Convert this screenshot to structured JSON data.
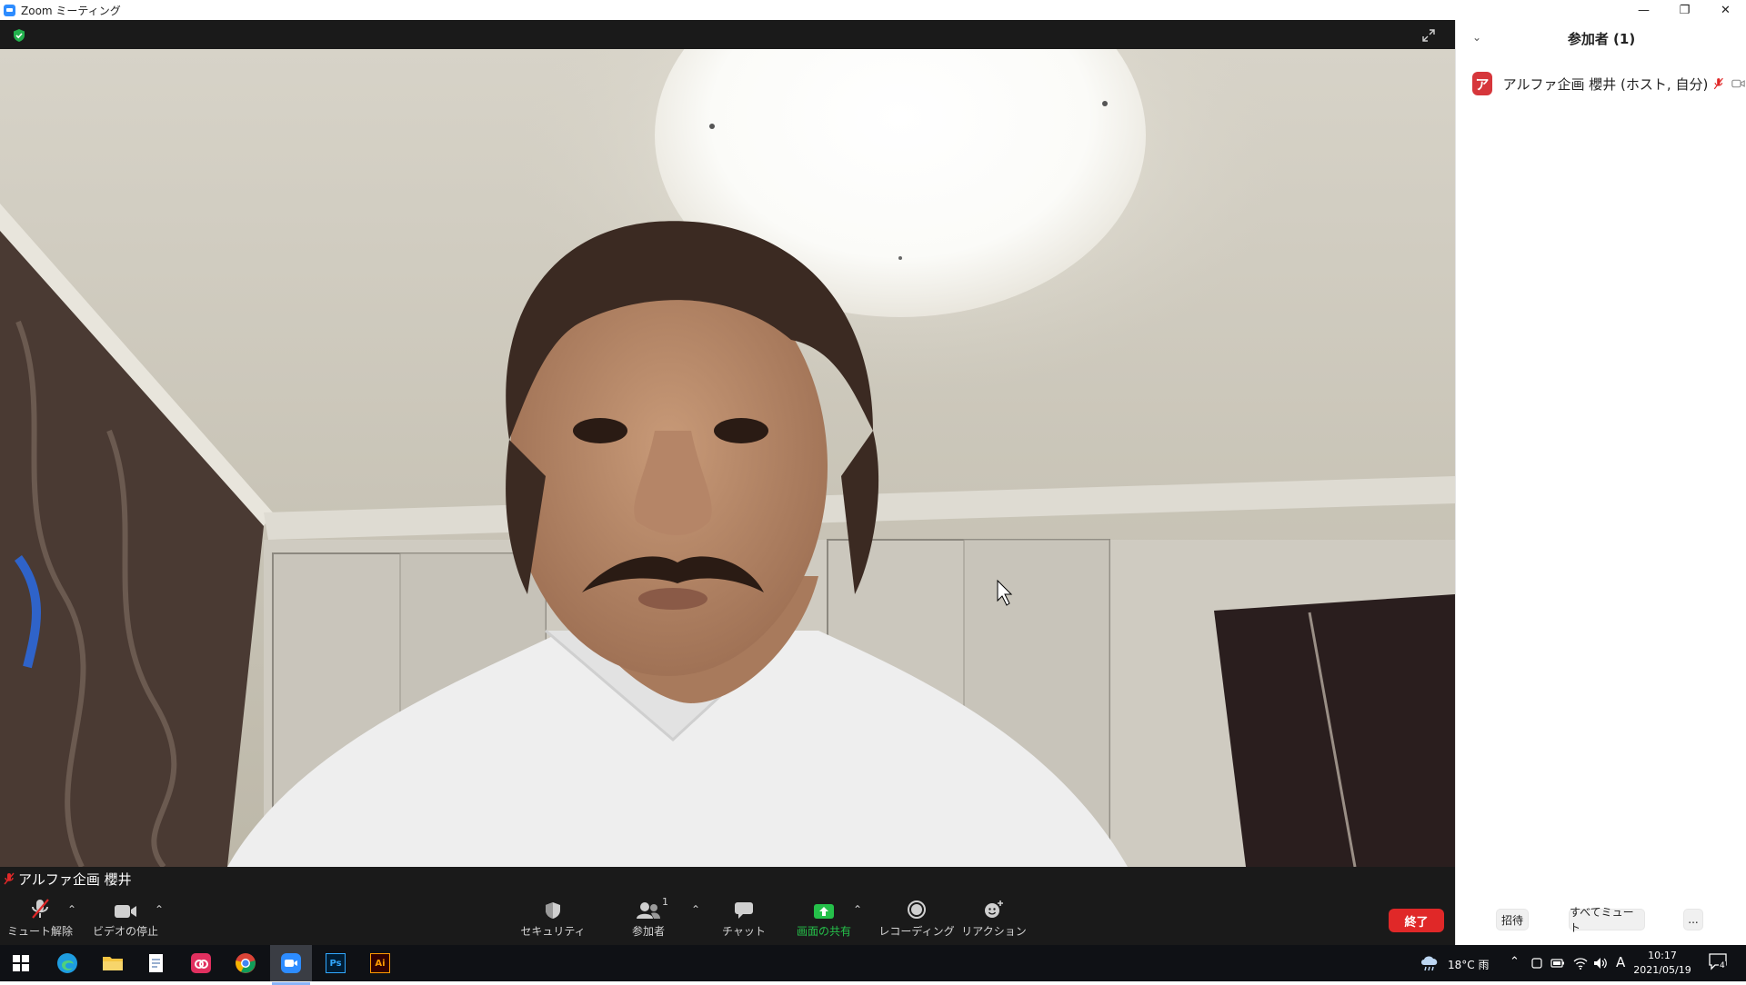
{
  "window": {
    "title": "Zoom ミーティング",
    "controls": [
      "—",
      "❐",
      "✕"
    ]
  },
  "video": {
    "participant_name": "アルファ企画 櫻井"
  },
  "toolbar": {
    "unmute": "ミュート解除",
    "stop_video": "ビデオの停止",
    "security": "セキュリティ",
    "participants": "参加者",
    "participants_count": "1",
    "chat": "チャット",
    "share_screen": "画面の共有",
    "recording": "レコーディング",
    "reactions": "リアクション",
    "end": "終了"
  },
  "panel": {
    "title": "参加者 (1)",
    "participant": {
      "avatar_letter": "ア",
      "name": "アルファ企画 櫻井 (ホスト, 自分)"
    },
    "invite": "招待",
    "mute_all": "すべてミュート",
    "more": "..."
  },
  "taskbar": {
    "weather": "18°C 雨",
    "ime": "A",
    "time": "10:17",
    "date": "2021/05/19",
    "notifications": "4",
    "apps": [
      "start-icon",
      "edge-icon",
      "file-explorer-icon",
      "notepad-icon",
      "creative-cloud-icon",
      "chrome-icon",
      "zoom-icon",
      "photoshop-icon",
      "illustrator-icon"
    ],
    "ps_label": "Ps",
    "ai_label": "Ai"
  },
  "colors": {
    "end_red": "#e02828",
    "share_green": "#25c04a",
    "avatar_red": "#d6363b"
  }
}
